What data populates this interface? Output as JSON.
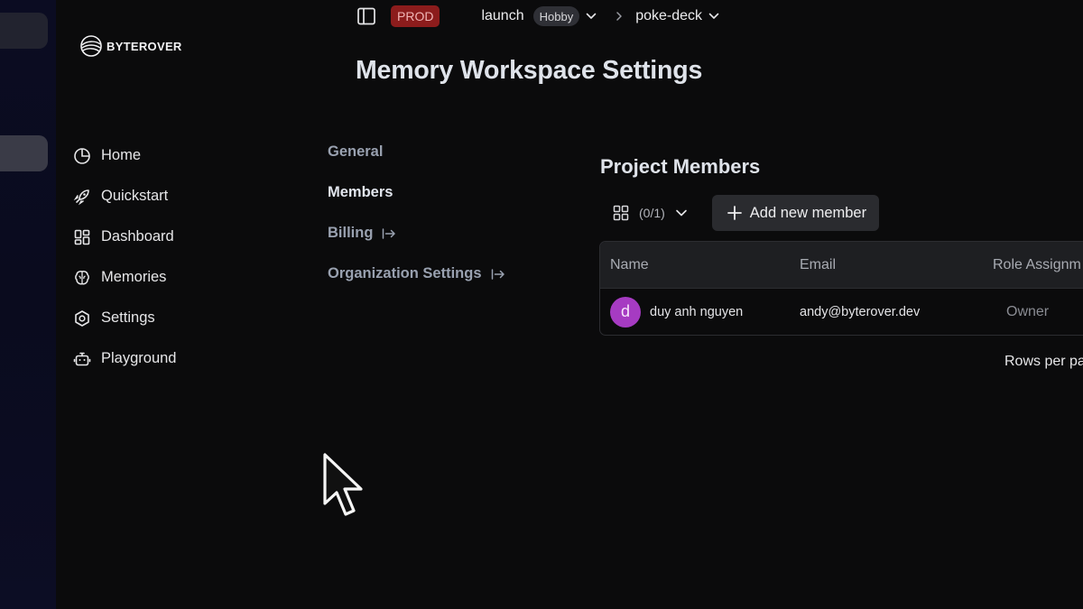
{
  "app": {
    "logo_text": "BYTEROVER"
  },
  "topbar": {
    "env_badge": "PROD",
    "workspace": "launch",
    "plan_badge": "Hobby",
    "project": "poke-deck"
  },
  "page": {
    "title": "Memory Workspace Settings"
  },
  "sidebar": {
    "items": [
      {
        "label": "Home",
        "icon": "pie-chart-icon"
      },
      {
        "label": "Quickstart",
        "icon": "rocket-icon"
      },
      {
        "label": "Dashboard",
        "icon": "dashboard-grid-icon"
      },
      {
        "label": "Memories",
        "icon": "brain-icon"
      },
      {
        "label": "Settings",
        "icon": "hexagon-settings-icon"
      },
      {
        "label": "Playground",
        "icon": "bot-icon"
      }
    ]
  },
  "settings_nav": {
    "items": [
      {
        "label": "General",
        "active": false,
        "external": false
      },
      {
        "label": "Members",
        "active": true,
        "external": false
      },
      {
        "label": "Billing",
        "active": false,
        "external": true
      },
      {
        "label": "Organization Settings",
        "active": false,
        "external": true
      }
    ]
  },
  "members": {
    "title": "Project Members",
    "selection_count": "(0/1)",
    "add_button_label": "Add new member",
    "columns": [
      "Name",
      "Email",
      "Role Assignm"
    ],
    "rows": [
      {
        "avatar_letter": "d",
        "name": "duy anh nguyen",
        "email": "andy@byterover.dev",
        "role": "Owner"
      }
    ],
    "rows_per_page_label": "Rows per pa"
  },
  "colors": {
    "background": "#0b0b0c",
    "env_badge_bg": "#8c1c1c",
    "avatar_bg": "#a63bc2",
    "button_bg": "#2a2b2f"
  }
}
